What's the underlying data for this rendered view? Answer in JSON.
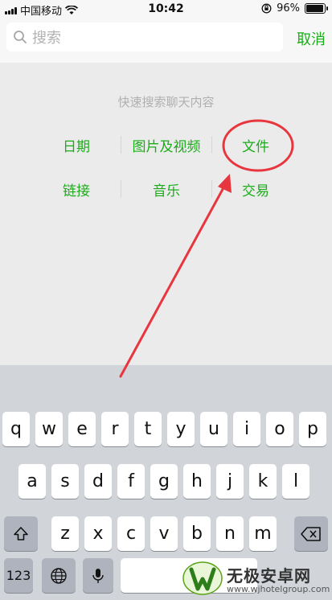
{
  "status_bar": {
    "carrier": "中国移动",
    "time": "10:42",
    "battery_text": "96%",
    "battery_level": 0.96
  },
  "search": {
    "placeholder": "搜索",
    "cancel_label": "取消"
  },
  "quick_search": {
    "title": "快速搜索聊天内容",
    "categories": [
      "日期",
      "图片及视频",
      "文件",
      "链接",
      "音乐",
      "交易"
    ]
  },
  "keyboard": {
    "row1": [
      "q",
      "w",
      "e",
      "r",
      "t",
      "y",
      "u",
      "i",
      "o",
      "p"
    ],
    "row2": [
      "a",
      "s",
      "d",
      "f",
      "g",
      "h",
      "j",
      "k",
      "l"
    ],
    "row3": [
      "z",
      "x",
      "c",
      "v",
      "b",
      "n",
      "m"
    ],
    "numbers_label": "123"
  },
  "watermark": {
    "name": "无极安卓网",
    "url": "www.wjhotelgroup.com"
  },
  "colors": {
    "accent": "#1aad19",
    "annotation": "#e8363e"
  }
}
